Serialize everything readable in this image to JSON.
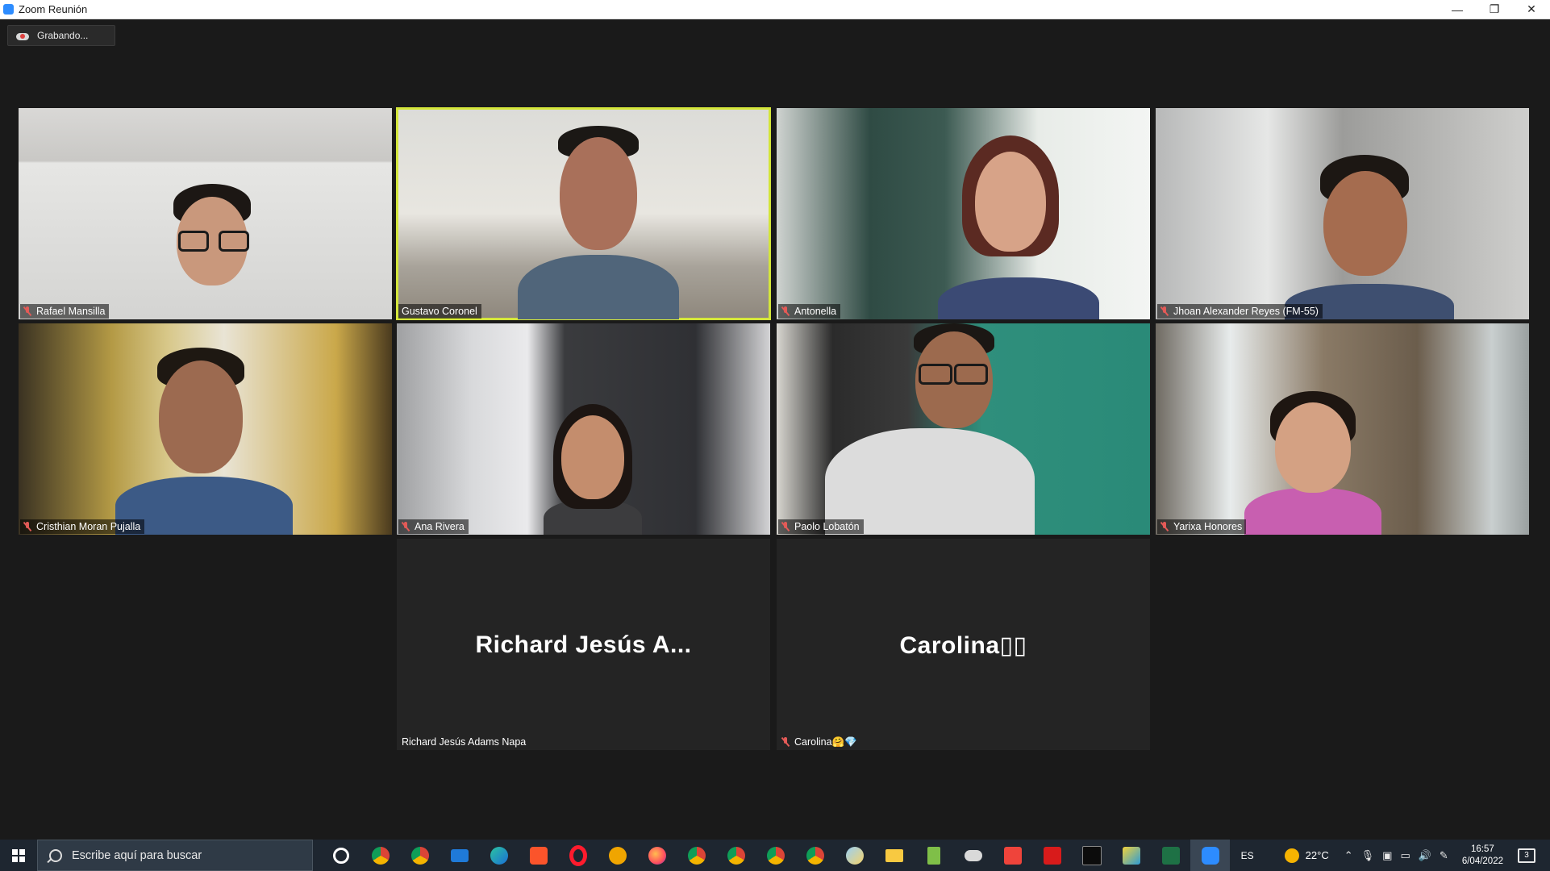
{
  "window": {
    "title": "Zoom Reunión",
    "controls": [
      "—",
      "❐",
      "✕"
    ]
  },
  "recording": {
    "label": "Grabando..."
  },
  "participants": [
    {
      "name": "Rafael Mansilla",
      "muted": true
    },
    {
      "name": "Gustavo Coronel",
      "muted": false,
      "speaking": true
    },
    {
      "name": "Antonella",
      "muted": true
    },
    {
      "name": "Jhoan Alexander Reyes (FM-55)",
      "muted": true
    },
    {
      "name": "Cristhian Moran Pujalla",
      "muted": true
    },
    {
      "name": "Ana Rivera",
      "muted": true
    },
    {
      "name": "Paolo Lobatón",
      "muted": true
    },
    {
      "name": "Yarixa Honores",
      "muted": true
    },
    {
      "name": "Richard Jesús Adams Napa",
      "display_name": "Richard Jesús A...",
      "muted": false,
      "video": false
    },
    {
      "name": "Carolina🤗💎",
      "display_name": "Carolina▯▯",
      "muted": true,
      "video": false
    }
  ],
  "taskbar": {
    "search_placeholder": "Escribe aquí para buscar",
    "apps": [
      "cortana-icon",
      "chrome-icon",
      "chrome-icon",
      "mail-icon",
      "edge-icon",
      "brave-icon",
      "opera-icon",
      "tor-icon",
      "firefox-icon",
      "chrome-icon",
      "chrome-icon",
      "chrome-icon",
      "chrome-icon",
      "paint-icon",
      "file-explorer-icon",
      "notepad-icon",
      "cloud-icon",
      "anydesk-icon",
      "acrobat-icon",
      "terminal-icon",
      "snip-icon",
      "excel-icon",
      "zoom-icon"
    ],
    "language": "ES",
    "temperature": "22°C",
    "time": "16:57",
    "date": "6/04/2022",
    "notifications": "3"
  },
  "colors": {
    "active_speaker": "#d4e63a",
    "muted_mic": "#e35a57",
    "taskbar": "#1e2630"
  }
}
